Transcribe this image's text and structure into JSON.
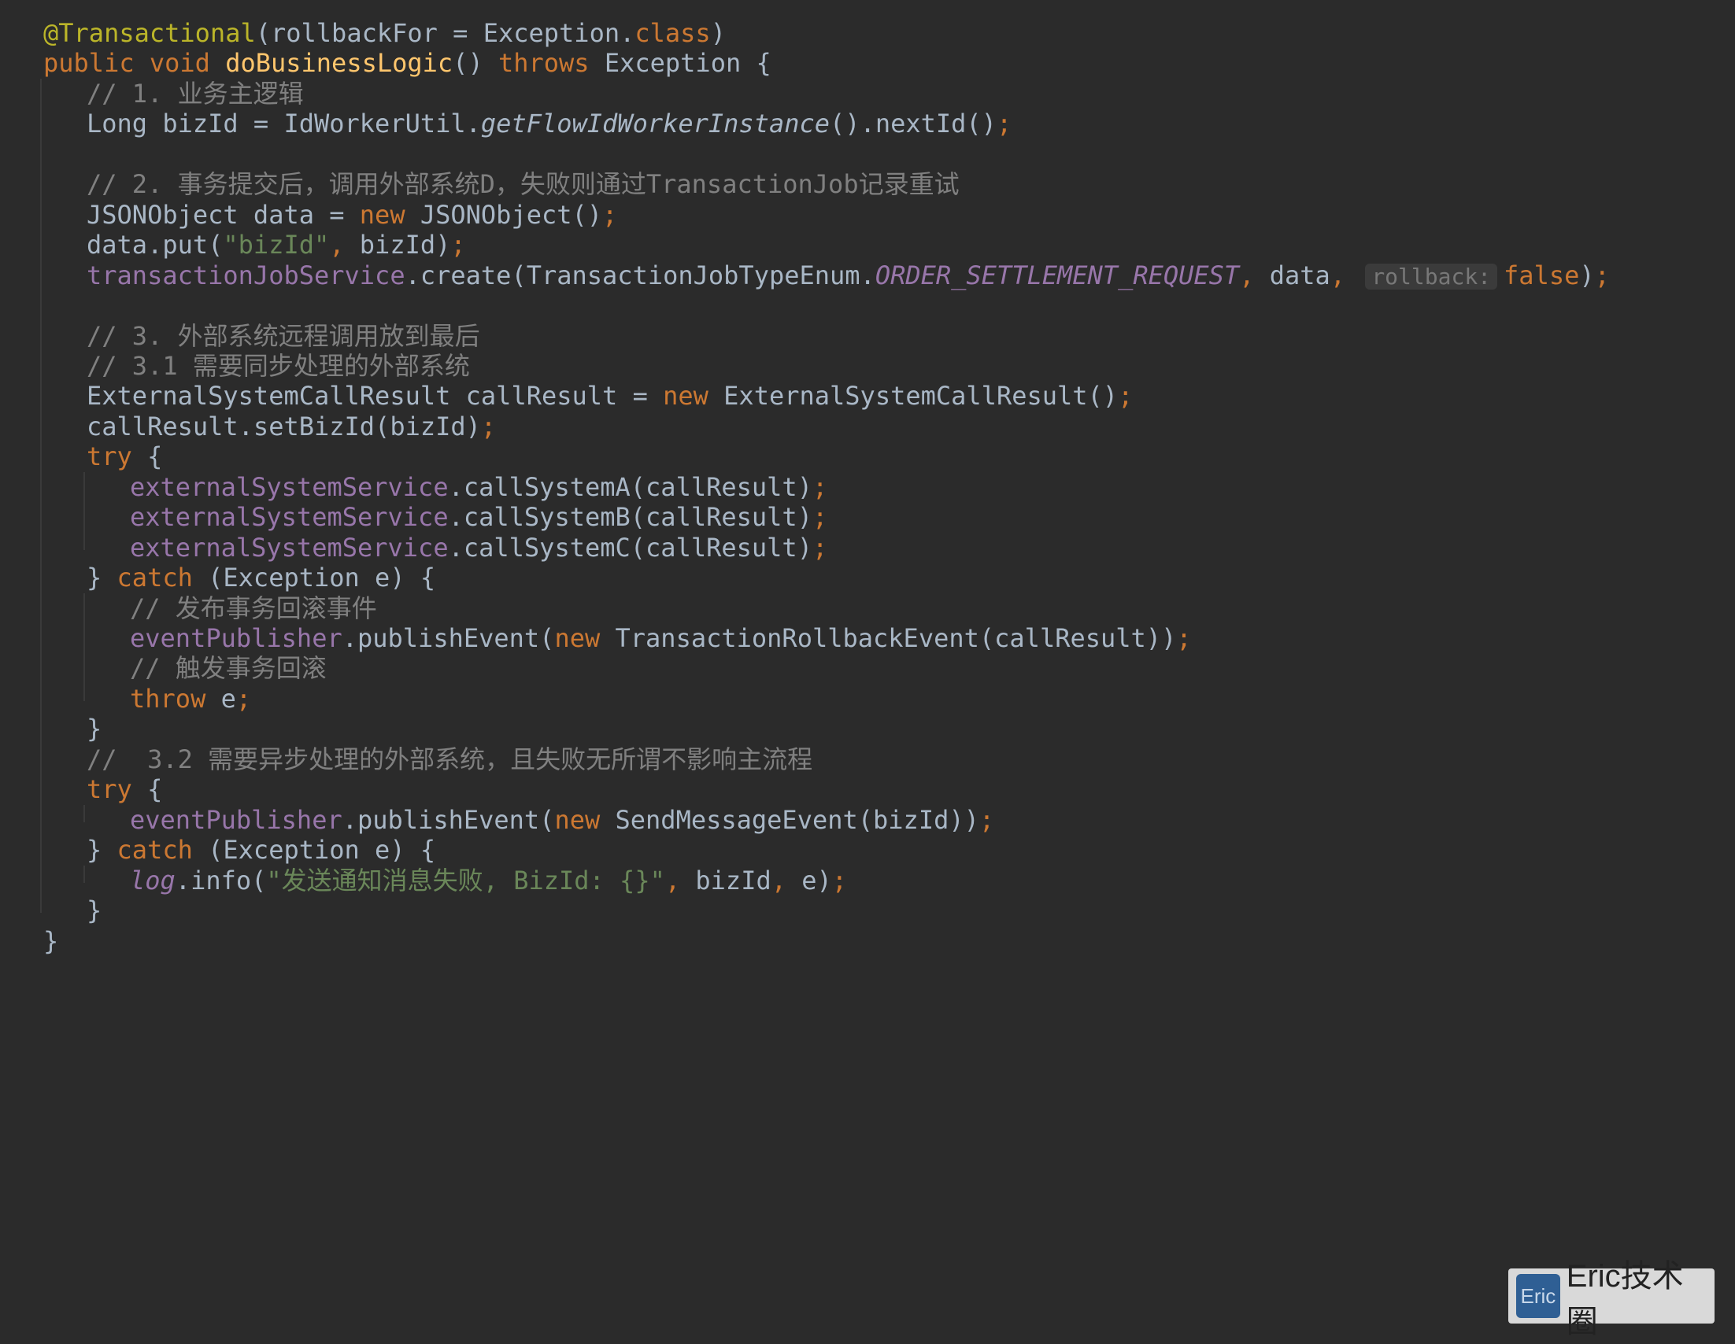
{
  "code": {
    "lines": [
      {
        "indent": 0,
        "tokens": [
          [
            "ann",
            "@Transactional"
          ],
          [
            "plain",
            "(rollbackFor = Exception."
          ],
          [
            "kw",
            "class"
          ],
          [
            "plain",
            ")"
          ]
        ]
      },
      {
        "indent": 0,
        "tokens": [
          [
            "kw",
            "public void "
          ],
          [
            "fn",
            "doBusinessLogic"
          ],
          [
            "plain",
            "() "
          ],
          [
            "kw",
            "throws "
          ],
          [
            "plain",
            "Exception {"
          ]
        ]
      },
      {
        "indent": 1,
        "tokens": [
          [
            "cmt",
            "// 1. 业务主逻辑"
          ]
        ]
      },
      {
        "indent": 1,
        "tokens": [
          [
            "plain",
            "Long bizId = IdWorkerUtil."
          ],
          [
            "ital-plain",
            "getFlowIdWorkerInstance"
          ],
          [
            "plain",
            "().nextId()"
          ],
          [
            "semi",
            ";"
          ]
        ]
      },
      {
        "indent": 1,
        "tokens": []
      },
      {
        "indent": 1,
        "tokens": [
          [
            "cmt",
            "// 2. 事务提交后，调用外部系统D，失败则通过TransactionJob记录重试"
          ]
        ]
      },
      {
        "indent": 1,
        "tokens": [
          [
            "plain",
            "JSONObject data = "
          ],
          [
            "kw",
            "new "
          ],
          [
            "plain",
            "JSONObject()"
          ],
          [
            "semi",
            ";"
          ]
        ]
      },
      {
        "indent": 1,
        "tokens": [
          [
            "plain",
            "data.put("
          ],
          [
            "str",
            "\"bizId\""
          ],
          [
            "semi",
            ", "
          ],
          [
            "plain",
            "bizId)"
          ],
          [
            "semi",
            ";"
          ]
        ]
      },
      {
        "indent": 1,
        "tokens": [
          [
            "fld",
            "transactionJobService"
          ],
          [
            "plain",
            ".create(TransactionJobTypeEnum."
          ],
          [
            "ital",
            "ORDER_SETTLEMENT_REQUEST"
          ],
          [
            "semi",
            ", "
          ],
          [
            "plain",
            "data"
          ],
          [
            "semi",
            ", "
          ],
          [
            "hint",
            "rollback:"
          ],
          [
            "kw",
            "false"
          ],
          [
            "plain",
            ")"
          ],
          [
            "semi",
            ";"
          ]
        ]
      },
      {
        "indent": 1,
        "tokens": []
      },
      {
        "indent": 1,
        "tokens": [
          [
            "cmt",
            "// 3. 外部系统远程调用放到最后"
          ]
        ]
      },
      {
        "indent": 1,
        "tokens": [
          [
            "cmt",
            "// 3.1 需要同步处理的外部系统"
          ]
        ]
      },
      {
        "indent": 1,
        "tokens": [
          [
            "plain",
            "ExternalSystemCallResult callResult = "
          ],
          [
            "kw",
            "new "
          ],
          [
            "plain",
            "ExternalSystemCallResult()"
          ],
          [
            "semi",
            ";"
          ]
        ]
      },
      {
        "indent": 1,
        "tokens": [
          [
            "plain",
            "callResult.setBizId(bizId)"
          ],
          [
            "semi",
            ";"
          ]
        ]
      },
      {
        "indent": 1,
        "tokens": [
          [
            "kw",
            "try "
          ],
          [
            "plain",
            "{"
          ]
        ]
      },
      {
        "indent": 2,
        "tokens": [
          [
            "fld",
            "externalSystemService"
          ],
          [
            "plain",
            ".callSystemA(callResult)"
          ],
          [
            "semi",
            ";"
          ]
        ]
      },
      {
        "indent": 2,
        "tokens": [
          [
            "fld",
            "externalSystemService"
          ],
          [
            "plain",
            ".callSystemB(callResult)"
          ],
          [
            "semi",
            ";"
          ]
        ]
      },
      {
        "indent": 2,
        "tokens": [
          [
            "fld",
            "externalSystemService"
          ],
          [
            "plain",
            ".callSystemC(callResult)"
          ],
          [
            "semi",
            ";"
          ]
        ]
      },
      {
        "indent": 1,
        "tokens": [
          [
            "plain",
            "} "
          ],
          [
            "kw",
            "catch "
          ],
          [
            "plain",
            "(Exception e) {"
          ]
        ]
      },
      {
        "indent": 2,
        "tokens": [
          [
            "cmt",
            "// 发布事务回滚事件"
          ]
        ]
      },
      {
        "indent": 2,
        "tokens": [
          [
            "fld",
            "eventPublisher"
          ],
          [
            "plain",
            ".publishEvent("
          ],
          [
            "kw",
            "new "
          ],
          [
            "plain",
            "TransactionRollbackEvent(callResult))"
          ],
          [
            "semi",
            ";"
          ]
        ]
      },
      {
        "indent": 2,
        "tokens": [
          [
            "cmt",
            "// 触发事务回滚"
          ]
        ]
      },
      {
        "indent": 2,
        "tokens": [
          [
            "kw",
            "throw "
          ],
          [
            "plain",
            "e"
          ],
          [
            "semi",
            ";"
          ]
        ]
      },
      {
        "indent": 1,
        "tokens": [
          [
            "plain",
            "}"
          ]
        ]
      },
      {
        "indent": 1,
        "tokens": [
          [
            "cmt",
            "//  3.2 需要异步处理的外部系统，且失败无所谓不影响主流程"
          ]
        ]
      },
      {
        "indent": 1,
        "tokens": [
          [
            "kw",
            "try "
          ],
          [
            "plain",
            "{"
          ]
        ]
      },
      {
        "indent": 2,
        "tokens": [
          [
            "fld",
            "eventPublisher"
          ],
          [
            "plain",
            ".publishEvent("
          ],
          [
            "kw",
            "new "
          ],
          [
            "plain",
            "SendMessageEvent(bizId))"
          ],
          [
            "semi",
            ";"
          ]
        ]
      },
      {
        "indent": 1,
        "tokens": [
          [
            "plain",
            "} "
          ],
          [
            "kw",
            "catch "
          ],
          [
            "plain",
            "(Exception e) {"
          ]
        ]
      },
      {
        "indent": 2,
        "tokens": [
          [
            "ital",
            "log"
          ],
          [
            "plain",
            ".info("
          ],
          [
            "str",
            "\"发送通知消息失败, BizId: {}\""
          ],
          [
            "semi",
            ", "
          ],
          [
            "plain",
            "bizId"
          ],
          [
            "semi",
            ", "
          ],
          [
            "plain",
            "e)"
          ],
          [
            "semi",
            ";"
          ]
        ]
      },
      {
        "indent": 1,
        "tokens": [
          [
            "plain",
            "}"
          ]
        ]
      },
      {
        "indent": 0,
        "tokens": [
          [
            "plain",
            "}"
          ]
        ]
      }
    ]
  },
  "watermark": {
    "logo_text": "Eric",
    "label": "Eric技术圈"
  },
  "colors": {
    "background": "#2b2b2b",
    "keyword": "#cc7832",
    "annotation": "#bbb529",
    "method_declaration": "#ffc66d",
    "field": "#9876aa",
    "string": "#6a8759",
    "comment": "#808080",
    "text": "#a9b7c6"
  }
}
